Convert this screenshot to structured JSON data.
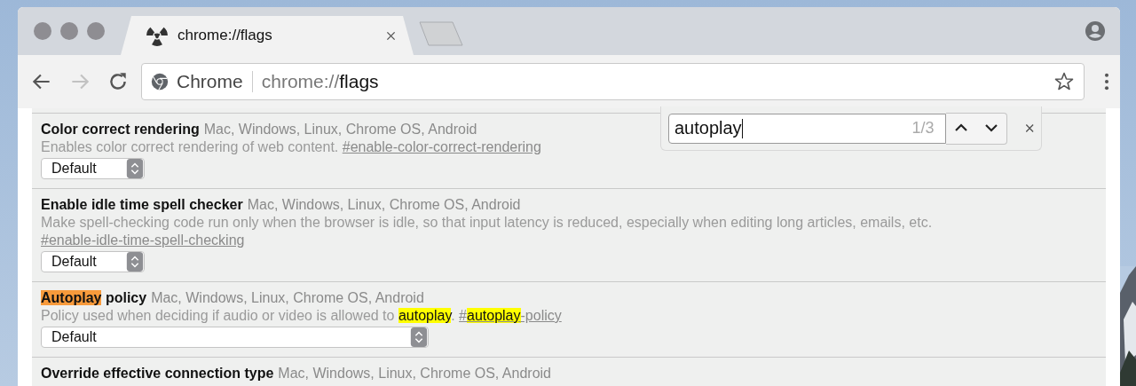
{
  "tabs": [
    {
      "title": "chrome://flags",
      "selected": true
    }
  ],
  "nav_buttons": [
    {
      "kind": "back",
      "disabled": false
    },
    {
      "kind": "forward",
      "disabled": true
    },
    {
      "kind": "reload",
      "disabled": false
    }
  ],
  "omnibox": {
    "chip": "Chrome",
    "url_prefix": "chrome://",
    "url_host": "flags"
  },
  "find_bar": {
    "value": "autoplay",
    "count": "1/3"
  },
  "flags": [
    {
      "name": [
        {
          "text": "Color correct rendering"
        }
      ],
      "platforms": "Mac, Windows, Linux, Chrome OS, Android",
      "description": [
        {
          "text": "Enables color correct rendering of web content. "
        }
      ],
      "link": [
        {
          "text": "#enable-color-correct-rendering"
        }
      ],
      "select": {
        "value": "Default",
        "kind": "compact"
      }
    },
    {
      "name": [
        {
          "text": "Enable idle time spell checker"
        }
      ],
      "platforms": "Mac, Windows, Linux, Chrome OS, Android",
      "description": [
        {
          "text": "Make spell-checking code run only when the browser is idle, so that input latency is reduced, especially when editing long articles, emails, etc. "
        }
      ],
      "link": [
        {
          "text": "#enable-idle-time-spell-checking"
        }
      ],
      "select": {
        "value": "Default",
        "kind": "compact"
      }
    },
    {
      "name": [
        {
          "text": "Autoplay",
          "highlighted": true,
          "current": true
        },
        {
          "text": " policy",
          "highlighted": false,
          "current": false
        }
      ],
      "platforms": "Mac, Windows, Linux, Chrome OS, Android",
      "description": [
        {
          "text": "Policy used when deciding if audio or video is allowed to ",
          "highlighted": false,
          "current": false
        },
        {
          "text": "autoplay",
          "highlighted": true,
          "current": false
        },
        {
          "text": ". ",
          "highlighted": false,
          "current": false
        }
      ],
      "link": [
        {
          "text": "#",
          "highlighted": false,
          "current": false
        },
        {
          "text": "autoplay",
          "highlighted": true,
          "current": false
        },
        {
          "text": "-policy",
          "highlighted": false,
          "current": false
        }
      ],
      "select": {
        "value": "Default",
        "kind": "wide"
      }
    },
    {
      "name": [
        {
          "text": "Override effective connection type"
        }
      ],
      "platforms": "Mac, Windows, Linux, Chrome OS, Android"
    }
  ]
}
